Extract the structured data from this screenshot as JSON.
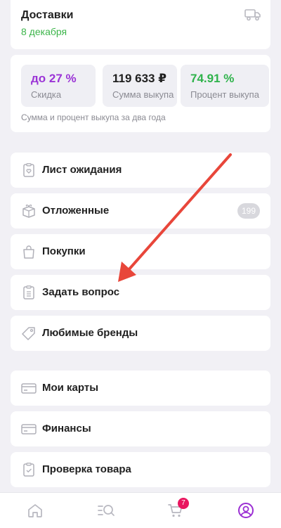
{
  "delivery": {
    "title": "Доставки",
    "date": "8 декабря"
  },
  "stats": {
    "discount": {
      "value": "до 27 %",
      "label": "Скидка",
      "color": "#9b34d6"
    },
    "sum": {
      "value": "119 633 ₽",
      "label": "Сумма выкупа"
    },
    "percent": {
      "value": "74.91 %",
      "label": "Процент выкупа",
      "color": "#2fb34b"
    },
    "note": "Сумма и процент выкупа за два года"
  },
  "menu_group1": [
    {
      "label": "Лист ожидания",
      "icon": "clipboard-heart-icon"
    },
    {
      "label": "Отложенные",
      "icon": "box-icon",
      "badge": "199"
    },
    {
      "label": "Покупки",
      "icon": "shopping-bag-icon"
    },
    {
      "label": "Задать вопрос",
      "icon": "document-list-icon"
    },
    {
      "label": "Любимые бренды",
      "icon": "tag-icon"
    }
  ],
  "menu_group2": [
    {
      "label": "Мои карты",
      "icon": "credit-card-icon"
    },
    {
      "label": "Финансы",
      "icon": "wallet-card-icon"
    },
    {
      "label": "Проверка товара",
      "icon": "clipboard-check-icon"
    }
  ],
  "tabbar": {
    "cart_count": "7",
    "active_color": "#9b2fd3",
    "icons": [
      "home-icon",
      "catalog-search-icon",
      "cart-icon",
      "profile-icon"
    ]
  },
  "annotation": {
    "arrow_color": "#e8463a"
  }
}
